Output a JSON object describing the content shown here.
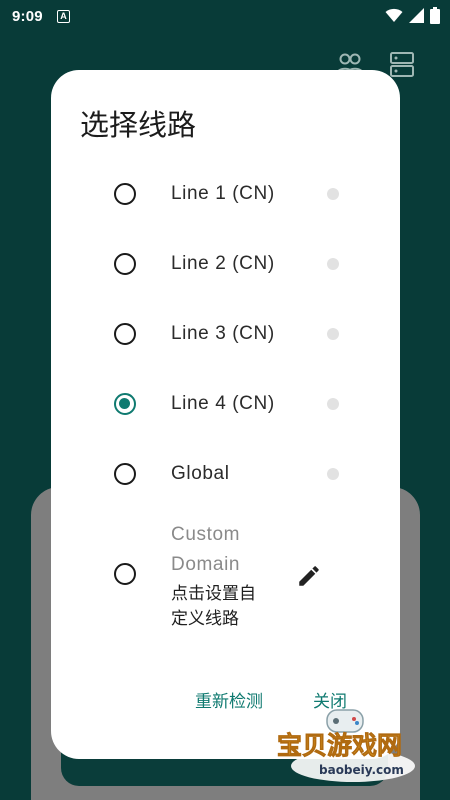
{
  "status_bar": {
    "time": "9:09",
    "notification_glyph": "A"
  },
  "dialog": {
    "title": "选择线路",
    "options": [
      {
        "label": "Line 1 (CN)",
        "selected": false
      },
      {
        "label": "Line 2 (CN)",
        "selected": false
      },
      {
        "label": "Line 3 (CN)",
        "selected": false
      },
      {
        "label": "Line 4 (CN)",
        "selected": true
      },
      {
        "label": "Global",
        "selected": false
      }
    ],
    "custom": {
      "title": "Custom Domain",
      "subtitle": "点击设置自定义线路"
    },
    "actions": {
      "recheck": "重新检测",
      "close": "关闭"
    }
  },
  "watermark": {
    "text_cn": "宝贝游戏网",
    "text_en": "baobeiy.com"
  },
  "colors": {
    "app_background": "#083b38",
    "accent": "#0f7a70",
    "dialog": "#ffffff"
  }
}
